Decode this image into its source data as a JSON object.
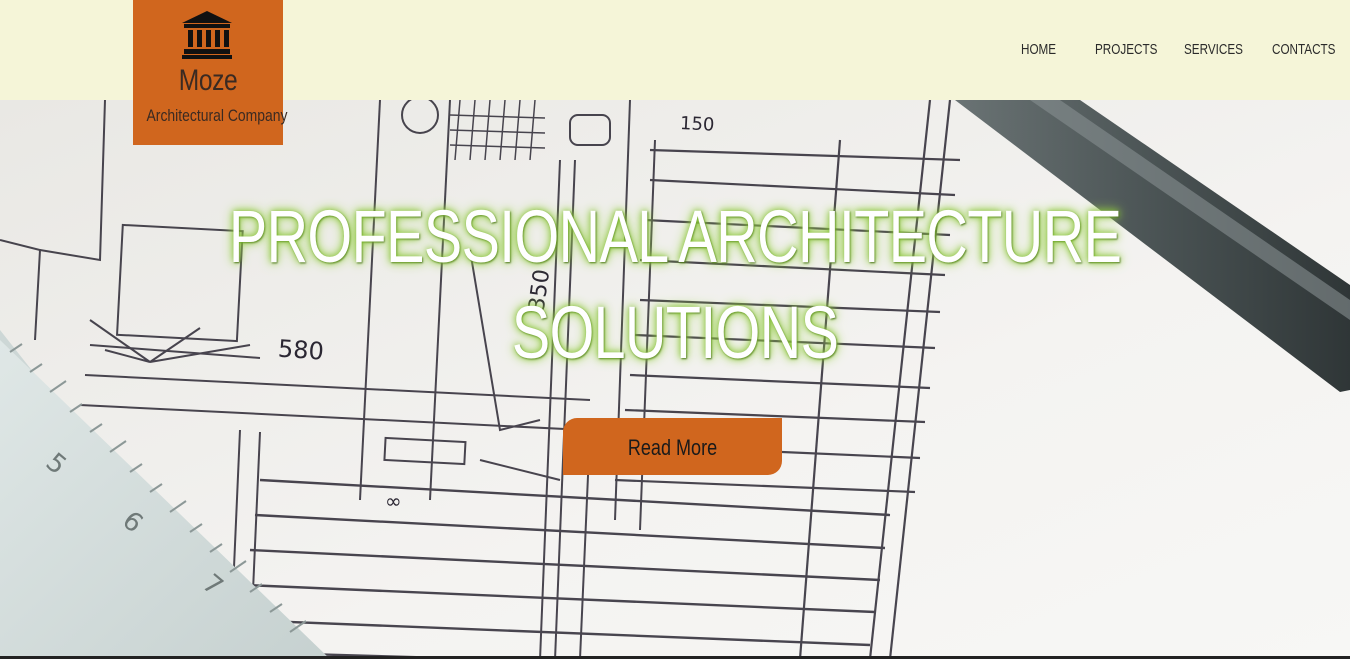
{
  "brand": {
    "name": "Moze",
    "tagline": "Architectural Company",
    "icon": "bank-building-icon",
    "color": "#d0661e"
  },
  "nav": {
    "items": [
      {
        "label": "HOME"
      },
      {
        "label": "PROJECTS"
      },
      {
        "label": "SERVICES"
      },
      {
        "label": "CONTACTS"
      }
    ]
  },
  "hero": {
    "headline_line1": "PROFESSIONAL ARCHITECTURE",
    "headline_line2": "SOLUTIONS",
    "cta_label": "Read More",
    "background": "architectural-blueprint-with-ruler-and-pen"
  },
  "colors": {
    "header_bg": "#f5f5d8",
    "accent": "#d0661e",
    "headline_glow": "#7fbf2a"
  }
}
